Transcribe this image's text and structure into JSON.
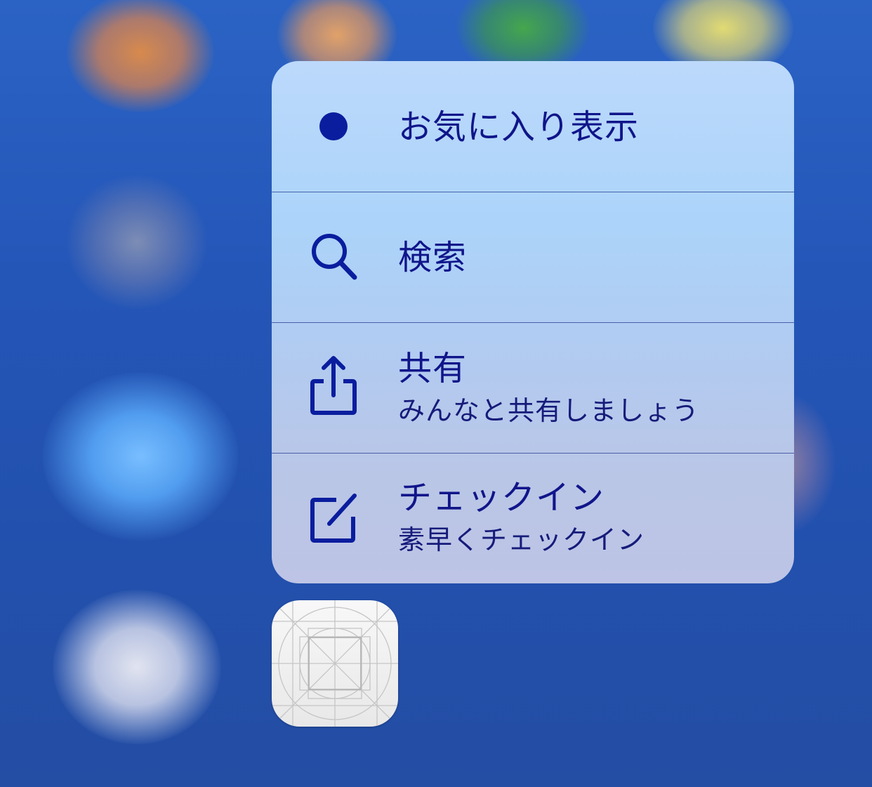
{
  "menu": {
    "items": [
      {
        "title": "お気に入り表示",
        "subtitle": "",
        "icon": "filled-circle-icon"
      },
      {
        "title": "検索",
        "subtitle": "",
        "icon": "search-icon"
      },
      {
        "title": "共有",
        "subtitle": "みんなと共有しましょう",
        "icon": "share-icon"
      },
      {
        "title": "チェックイン",
        "subtitle": "素早くチェックイン",
        "icon": "compose-icon"
      }
    ]
  },
  "app_icon": {
    "icon": "app-icon-template"
  },
  "colors": {
    "menu_text": "#10158a",
    "menu_icon": "#0a1d9e",
    "divider": "#1e328c",
    "background": "#2456b8"
  }
}
